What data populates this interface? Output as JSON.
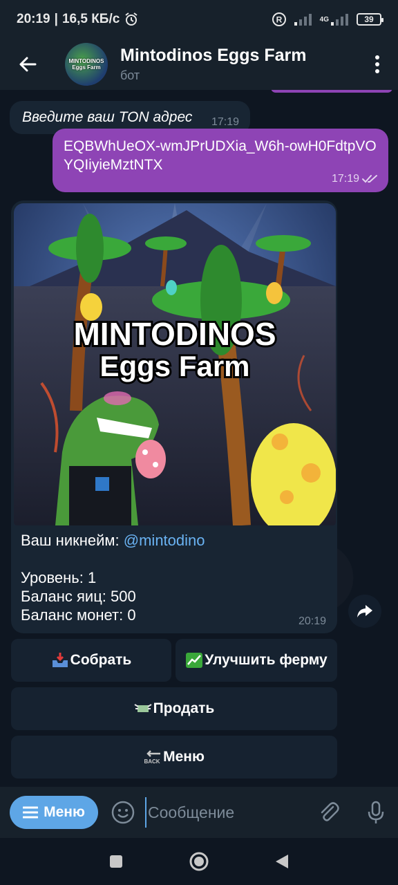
{
  "status": {
    "time": "20:19",
    "network_speed": "16,5 КБ/с",
    "network_type": "4G",
    "battery": "39"
  },
  "header": {
    "title": "Mintodinos Eggs Farm",
    "subtitle": "бот",
    "avatar_text": "MINTODINOS Eggs Farm"
  },
  "messages": [
    {
      "type": "in",
      "text": "Введите ваш TON адрес",
      "time": "17:19"
    },
    {
      "type": "out",
      "text": "EQBWhUeOX-wmJPrUDXia_W6h-owH0FdtpVOYQIiyieMztNTX",
      "time": "17:19"
    },
    {
      "type": "in-media",
      "image_title_line1": "MINTODINOS",
      "image_title_line2": "Eggs Farm",
      "nickname_label": "Ваш никнейм: ",
      "nickname": "@mintodino",
      "level": "Уровень: 1",
      "eggs": "Баланс яиц: 500",
      "coins": "Баланс монет: 0",
      "time": "20:19"
    }
  ],
  "keyboard": {
    "collect": "Собрать",
    "upgrade": "Улучшить ферму",
    "sell": "Продать",
    "menu": "Меню",
    "back_text": "BACK"
  },
  "composer": {
    "menu_label": "Меню",
    "placeholder": "Сообщение"
  },
  "colors": {
    "accent": "#5ea6e6",
    "outgoing": "#8e44b5",
    "incoming": "#182533",
    "link": "#6ab3f3"
  }
}
